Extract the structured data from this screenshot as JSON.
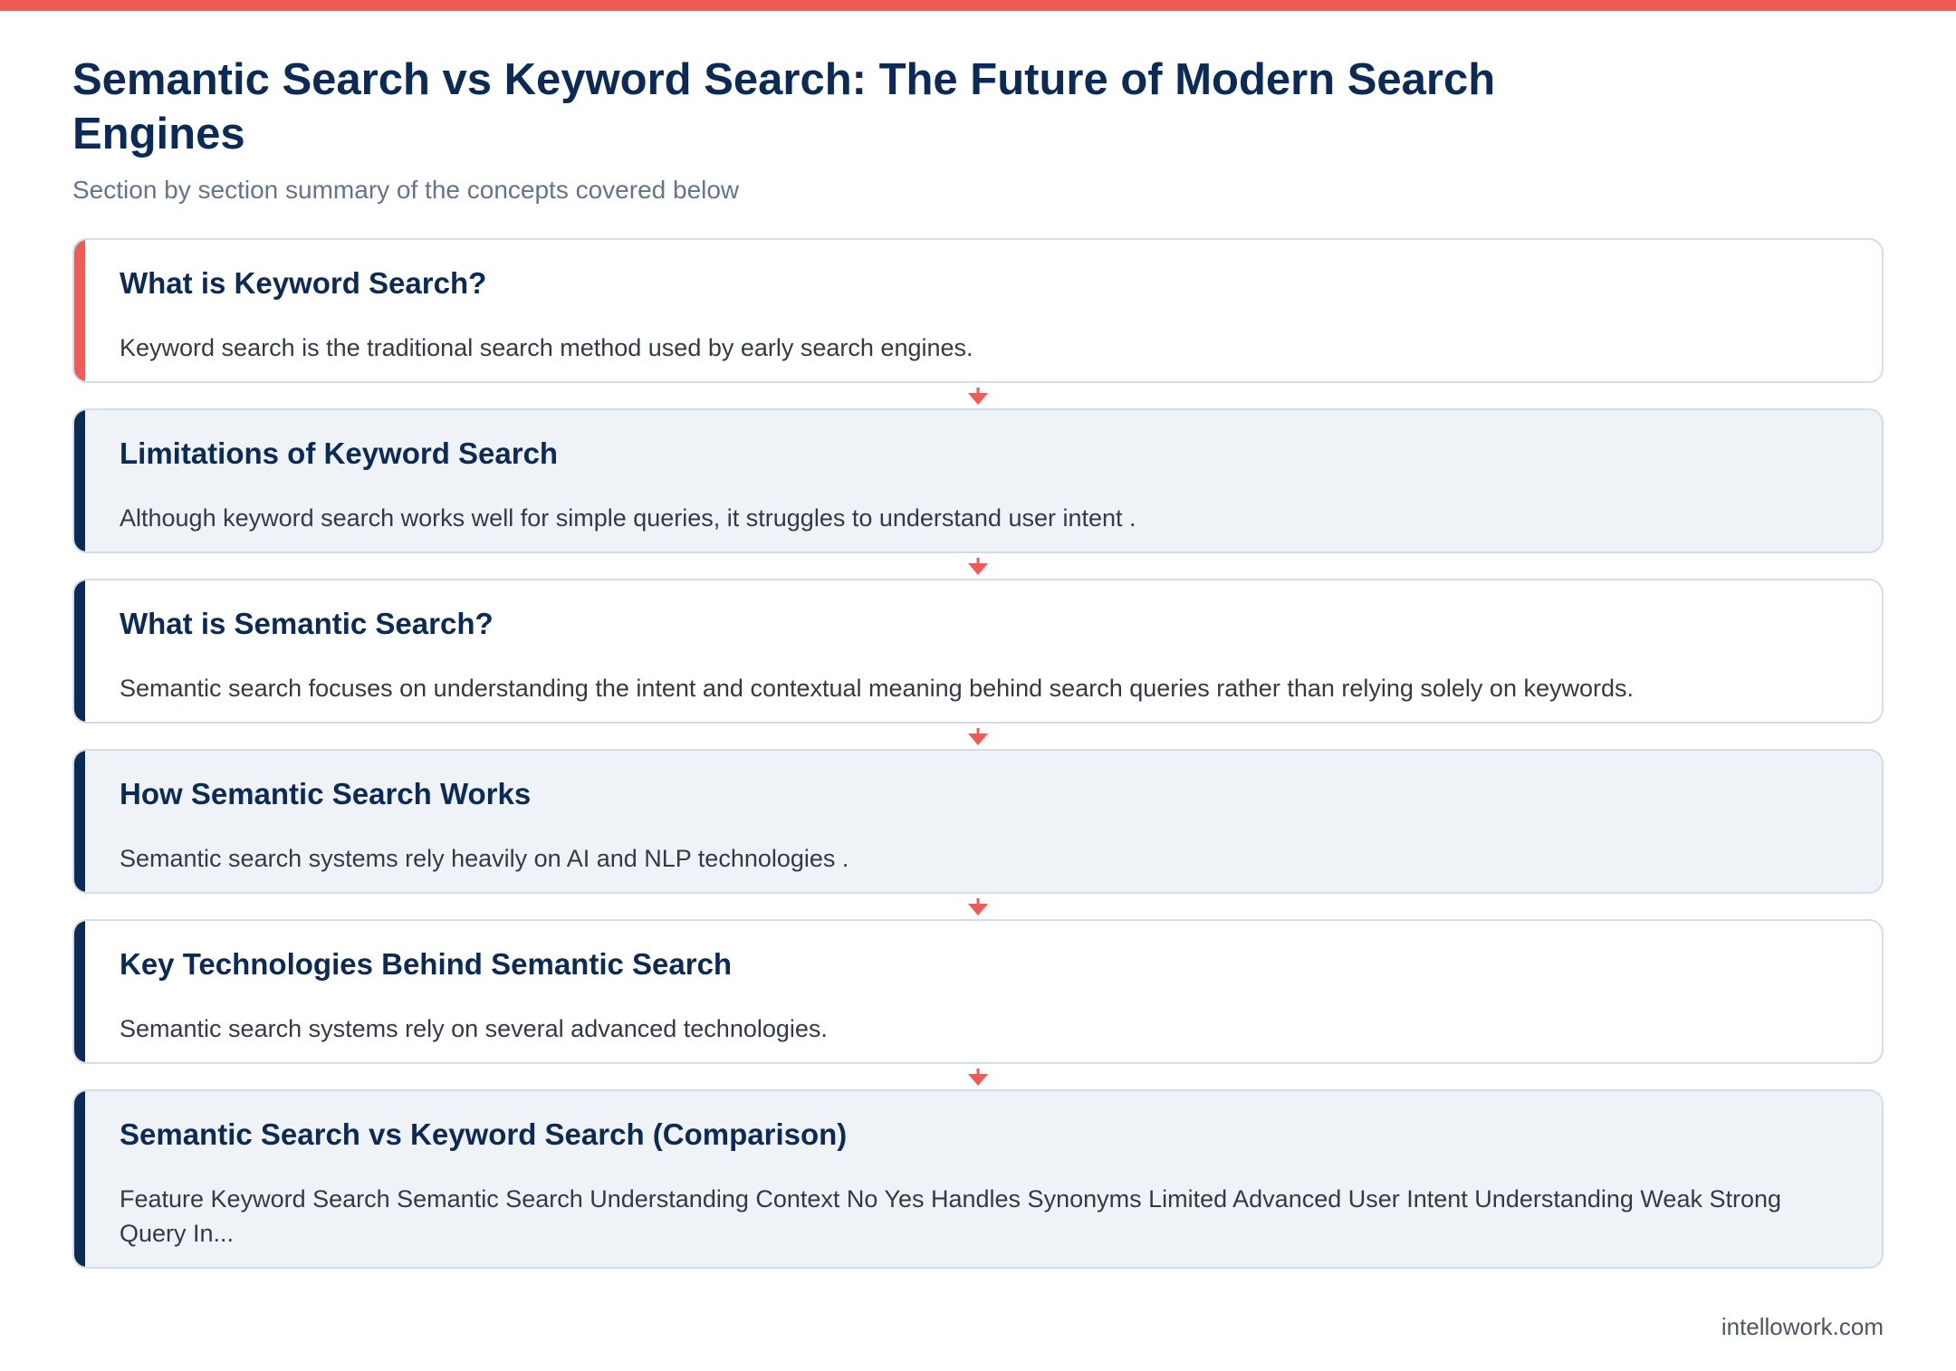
{
  "header": {
    "title": "Semantic Search vs Keyword Search: The Future of Modern Search Engines",
    "subtitle": "Section by section summary of the concepts covered below"
  },
  "steps": [
    {
      "heading": "What is Keyword Search?",
      "description": "Keyword search is the traditional search method used by early search engines."
    },
    {
      "heading": "Limitations of Keyword Search",
      "description": "Although keyword search works well for simple queries, it struggles to understand user intent ."
    },
    {
      "heading": "What is Semantic Search?",
      "description": "Semantic search focuses on understanding the intent and contextual meaning behind search queries rather than relying solely on keywords."
    },
    {
      "heading": "How Semantic Search Works",
      "description": "Semantic search systems rely heavily on AI and NLP technologies ."
    },
    {
      "heading": "Key Technologies Behind Semantic Search",
      "description": "Semantic search systems rely on several advanced technologies."
    },
    {
      "heading": "Semantic Search vs Keyword Search (Comparison)",
      "description": "Feature Keyword Search Semantic Search Understanding Context No Yes Handles Synonyms Limited Advanced User Intent Understanding Weak Strong Query In..."
    }
  ],
  "footer": {
    "source": "intellowork.com"
  },
  "colors": {
    "accent_red": "#ef5b57",
    "navy": "#0b2a55",
    "alt_card_bg": "#eff3f7",
    "card_border": "#d4dde8"
  },
  "icons": {
    "connector": "arrow-down-icon"
  }
}
